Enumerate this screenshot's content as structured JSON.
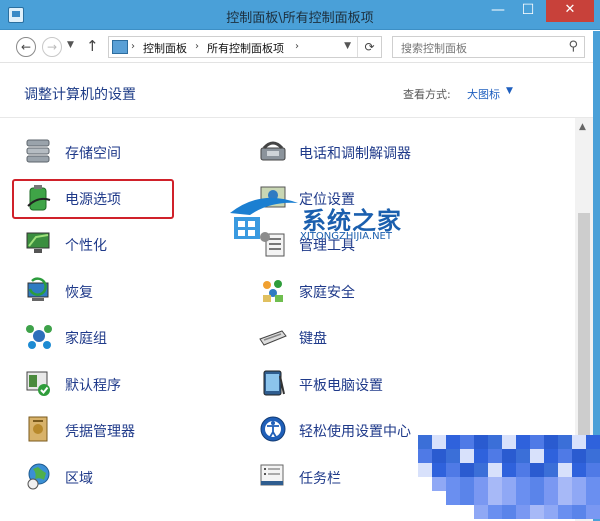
{
  "window": {
    "title": "控制面板\\所有控制面板项",
    "minimize": "—",
    "maximize": "☐",
    "close": "✕"
  },
  "address": {
    "crumbs": [
      "控制面板",
      "所有控制面板项"
    ],
    "search_placeholder": "搜索控制面板"
  },
  "header": {
    "heading": "调整计算机的设置",
    "view_label": "查看方式:",
    "view_value": "大图标"
  },
  "items": {
    "left": [
      "存储空间",
      "电源选项",
      "个性化",
      "恢复",
      "家庭组",
      "默认程序",
      "凭据管理器",
      "区域"
    ],
    "right": [
      "电话和调制解调器",
      "定位设置",
      "管理工具",
      "家庭安全",
      "键盘",
      "平板电脑设置",
      "轻松使用设置中心",
      "任务栏"
    ]
  },
  "watermark": {
    "text": "系统之家",
    "sub": "XITONGZHIJIA.NET"
  },
  "colors": {
    "titlebar": "#4aa0d8",
    "link": "#1f3a8a",
    "highlight_border": "#d0212a"
  }
}
